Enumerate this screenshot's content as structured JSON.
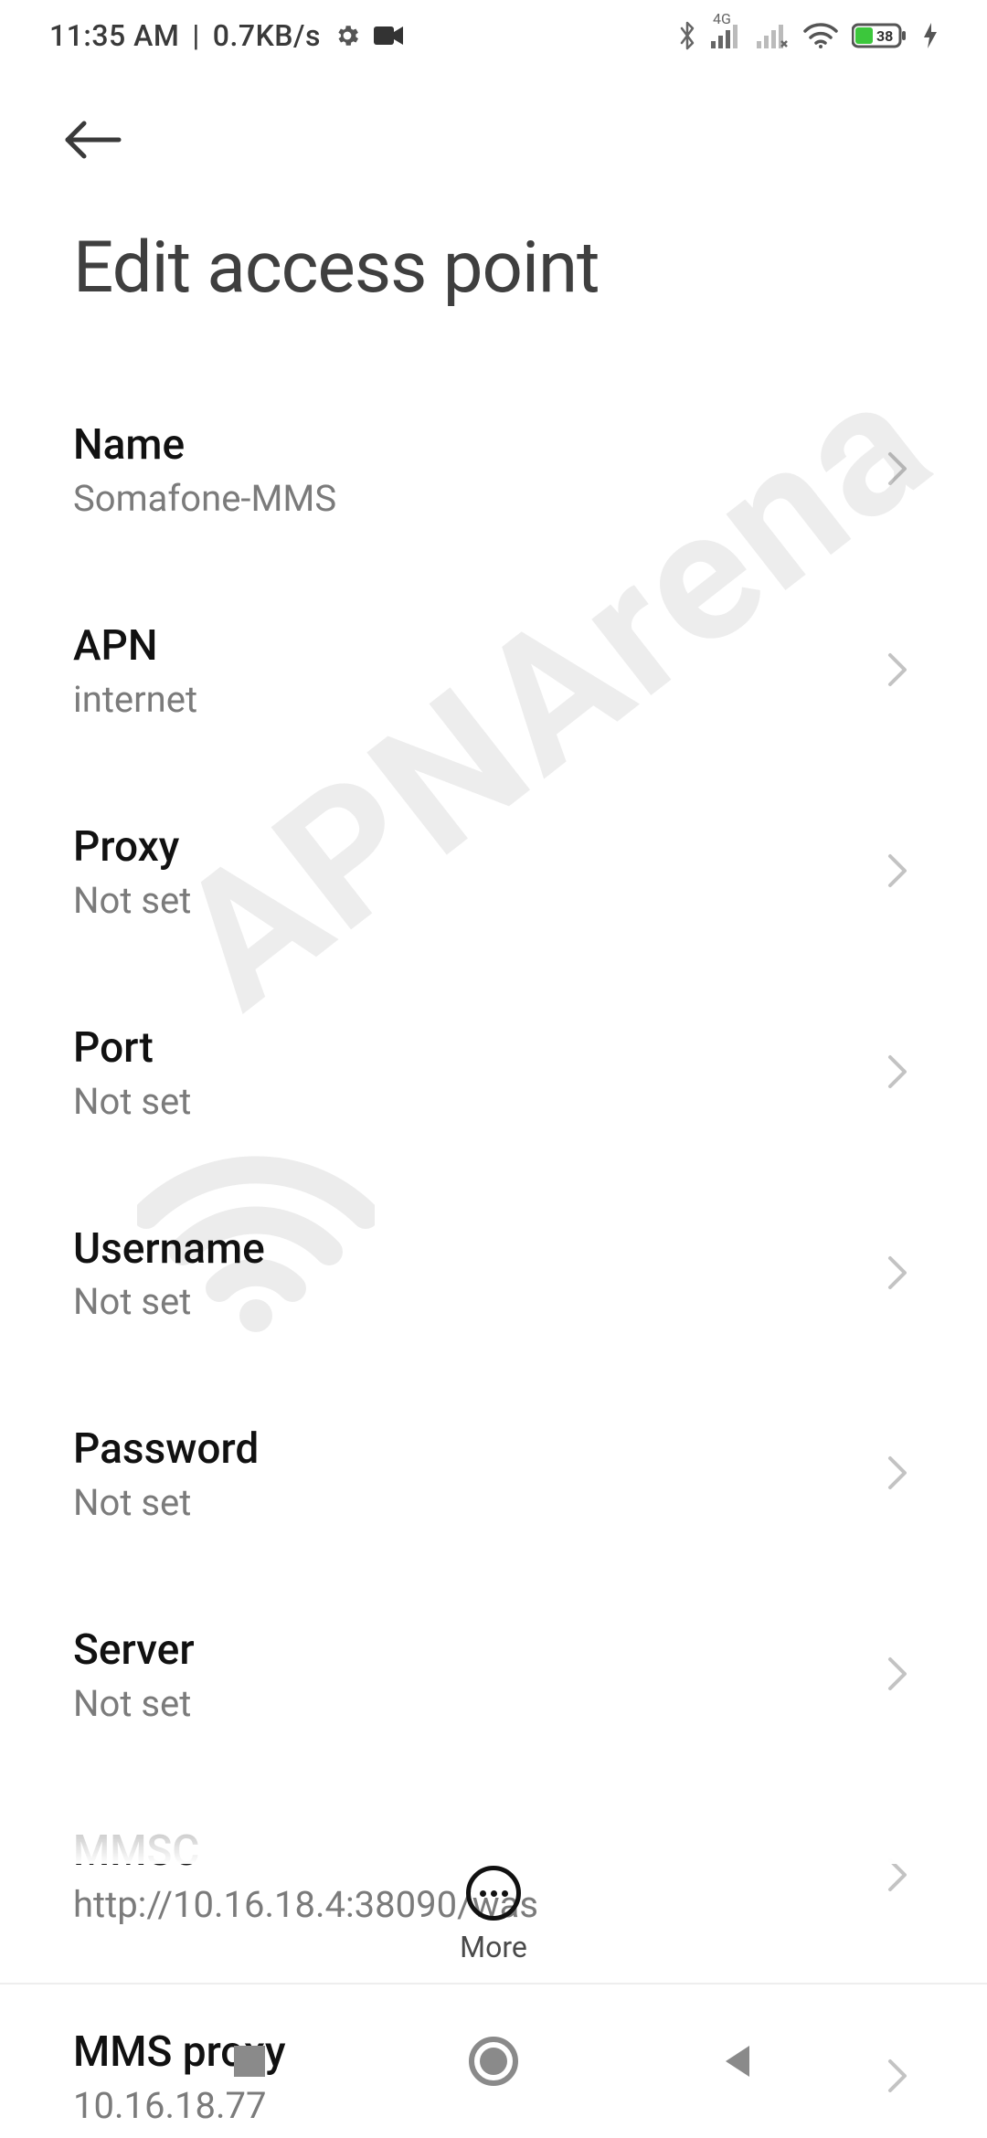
{
  "status": {
    "time": "11:35 AM",
    "sep": "|",
    "rate": "0.7KB/s",
    "network_4g": "4G",
    "battery_pct": "38"
  },
  "screen": {
    "title": "Edit access point"
  },
  "items": [
    {
      "label": "Name",
      "value": "Somafone-MMS"
    },
    {
      "label": "APN",
      "value": "internet"
    },
    {
      "label": "Proxy",
      "value": "Not set"
    },
    {
      "label": "Port",
      "value": "Not set"
    },
    {
      "label": "Username",
      "value": "Not set"
    },
    {
      "label": "Password",
      "value": "Not set"
    },
    {
      "label": "Server",
      "value": "Not set"
    },
    {
      "label": "MMSC",
      "value": "http://10.16.18.4:38090/was"
    },
    {
      "label": "MMS proxy",
      "value": "10.16.18.77"
    }
  ],
  "actions": {
    "more": "More"
  },
  "watermark": {
    "text": "APNArena"
  }
}
